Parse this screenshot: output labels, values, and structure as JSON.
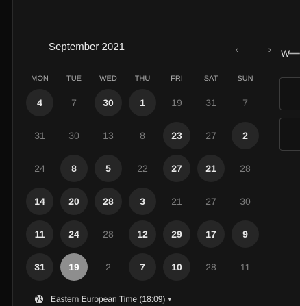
{
  "calendar": {
    "month_label": "September 2021",
    "prev_icon": "chevron-left-icon",
    "next_icon": "chevron-right-icon",
    "weekdays": [
      "MON",
      "TUE",
      "WED",
      "THU",
      "FRI",
      "SAT",
      "SUN"
    ],
    "weeks": [
      [
        {
          "d": "4",
          "s": "available"
        },
        {
          "d": "7",
          "s": "unavailable"
        },
        {
          "d": "30",
          "s": "available"
        },
        {
          "d": "1",
          "s": "available"
        },
        {
          "d": "19",
          "s": "unavailable"
        },
        {
          "d": "31",
          "s": "unavailable"
        },
        {
          "d": "7",
          "s": "unavailable"
        }
      ],
      [
        {
          "d": "31",
          "s": "unavailable"
        },
        {
          "d": "30",
          "s": "unavailable"
        },
        {
          "d": "13",
          "s": "unavailable"
        },
        {
          "d": "8",
          "s": "unavailable"
        },
        {
          "d": "23",
          "s": "available"
        },
        {
          "d": "27",
          "s": "unavailable"
        },
        {
          "d": "2",
          "s": "available"
        }
      ],
      [
        {
          "d": "24",
          "s": "unavailable"
        },
        {
          "d": "8",
          "s": "available"
        },
        {
          "d": "5",
          "s": "available"
        },
        {
          "d": "22",
          "s": "unavailable"
        },
        {
          "d": "27",
          "s": "available"
        },
        {
          "d": "21",
          "s": "available"
        },
        {
          "d": "28",
          "s": "unavailable"
        }
      ],
      [
        {
          "d": "14",
          "s": "available"
        },
        {
          "d": "20",
          "s": "available"
        },
        {
          "d": "28",
          "s": "available"
        },
        {
          "d": "3",
          "s": "available"
        },
        {
          "d": "21",
          "s": "unavailable"
        },
        {
          "d": "27",
          "s": "unavailable"
        },
        {
          "d": "30",
          "s": "unavailable"
        }
      ],
      [
        {
          "d": "11",
          "s": "available"
        },
        {
          "d": "24",
          "s": "available"
        },
        {
          "d": "28",
          "s": "unavailable"
        },
        {
          "d": "12",
          "s": "available"
        },
        {
          "d": "29",
          "s": "available"
        },
        {
          "d": "17",
          "s": "available"
        },
        {
          "d": "9",
          "s": "available"
        }
      ],
      [
        {
          "d": "31",
          "s": "available"
        },
        {
          "d": "19",
          "s": "selected"
        },
        {
          "d": "2",
          "s": "unavailable"
        },
        {
          "d": "7",
          "s": "available"
        },
        {
          "d": "10",
          "s": "available"
        },
        {
          "d": "28",
          "s": "unavailable"
        },
        {
          "d": "11",
          "s": "unavailable"
        }
      ]
    ]
  },
  "side_panel": {
    "label": "W"
  },
  "timezone": {
    "icon": "globe-icon",
    "label": "Eastern European Time (18:09)",
    "caret_icon": "caret-down-icon"
  },
  "colors": {
    "background": "#151515",
    "available_day": "#262626",
    "selected_day": "#8e8e8e"
  }
}
